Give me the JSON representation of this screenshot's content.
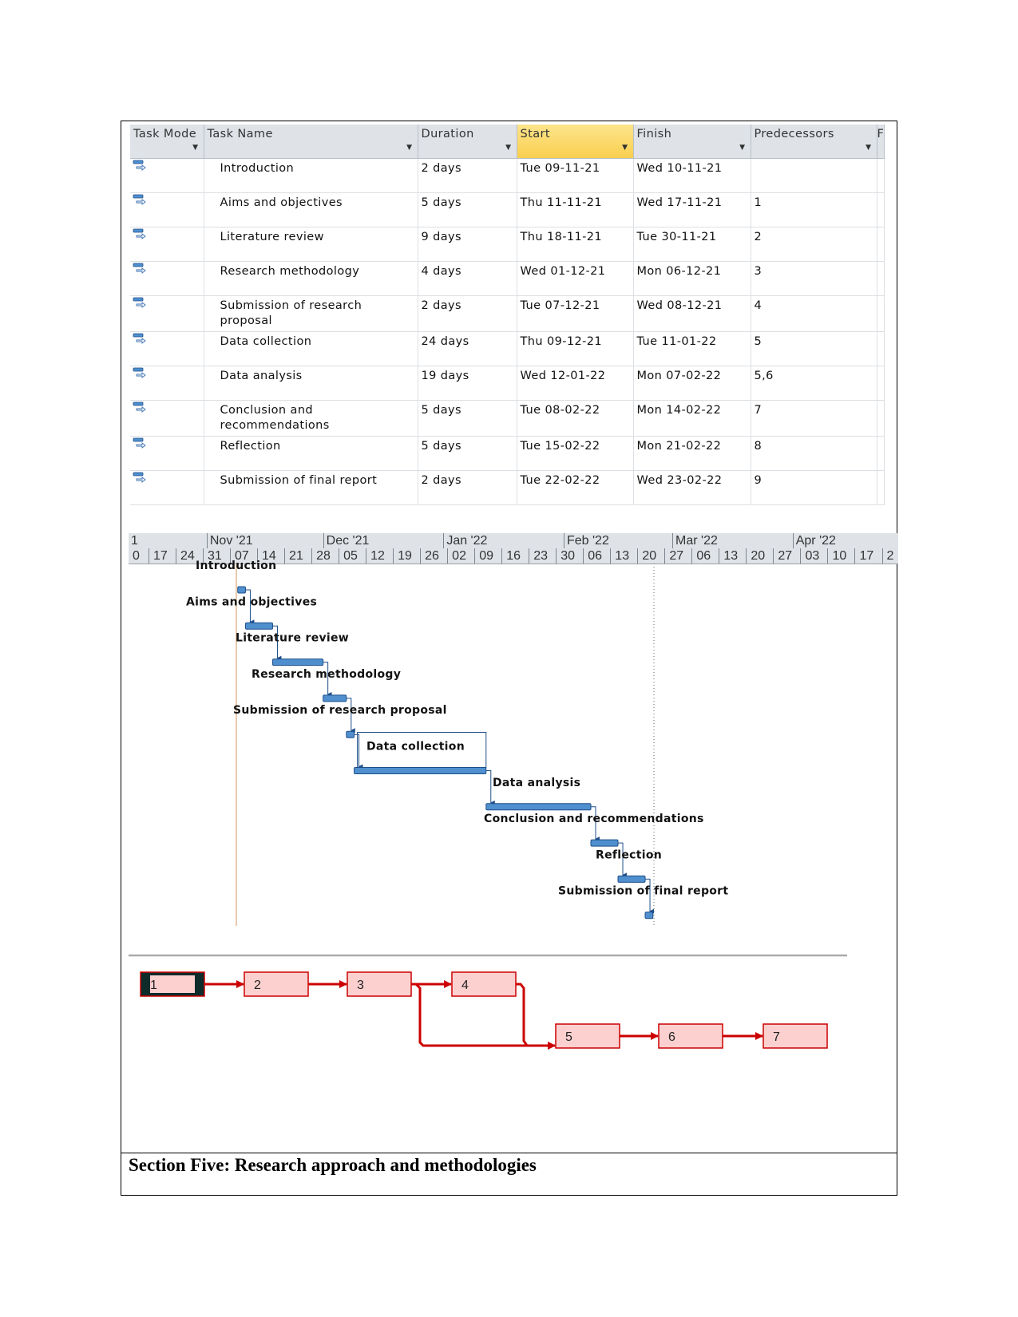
{
  "table": {
    "headers": [
      "Task Mode",
      "Task Name",
      "Duration",
      "Start",
      "Finish",
      "Predecessors",
      "F"
    ],
    "rows": [
      {
        "id": 1,
        "name": "Introduction",
        "duration": "2 days",
        "start": "Tue 09-11-21",
        "finish": "Wed 10-11-21",
        "predecessors": ""
      },
      {
        "id": 2,
        "name": "Aims and objectives",
        "duration": "5 days",
        "start": "Thu 11-11-21",
        "finish": "Wed 17-11-21",
        "predecessors": "1"
      },
      {
        "id": 3,
        "name": "Literature review",
        "duration": "9 days",
        "start": "Thu 18-11-21",
        "finish": "Tue 30-11-21",
        "predecessors": "2"
      },
      {
        "id": 4,
        "name": "Research methodology",
        "duration": "4 days",
        "start": "Wed 01-12-21",
        "finish": "Mon 06-12-21",
        "predecessors": "3"
      },
      {
        "id": 5,
        "name": "Submission of research proposal",
        "duration": "2 days",
        "start": "Tue 07-12-21",
        "finish": "Wed 08-12-21",
        "predecessors": "4"
      },
      {
        "id": 6,
        "name": "Data collection",
        "duration": "24 days",
        "start": "Thu 09-12-21",
        "finish": "Tue 11-01-22",
        "predecessors": "5"
      },
      {
        "id": 7,
        "name": "Data analysis",
        "duration": "19 days",
        "start": "Wed 12-01-22",
        "finish": "Mon 07-02-22",
        "predecessors": "5,6"
      },
      {
        "id": 8,
        "name": "Conclusion and recommendations",
        "duration": "5 days",
        "start": "Tue 08-02-22",
        "finish": "Mon 14-02-22",
        "predecessors": "7"
      },
      {
        "id": 9,
        "name": "Reflection",
        "duration": "5 days",
        "start": "Tue 15-02-22",
        "finish": "Mon 21-02-22",
        "predecessors": "8"
      },
      {
        "id": 10,
        "name": "Submission of final report",
        "duration": "2 days",
        "start": "Tue 22-02-22",
        "finish": "Wed 23-02-22",
        "predecessors": "9"
      }
    ],
    "task_mode_icon": "auto-scheduled-task-icon"
  },
  "timescale": {
    "months": [
      {
        "label": "1",
        "start": "01-10-21"
      },
      {
        "label": "Nov '21",
        "start": "01-11-21"
      },
      {
        "label": "Dec '21",
        "start": "01-12-21"
      },
      {
        "label": "Jan '22",
        "start": "01-01-22"
      },
      {
        "label": "Feb '22",
        "start": "01-02-22"
      },
      {
        "label": "Mar '22",
        "start": "01-03-22"
      },
      {
        "label": "Apr '22",
        "start": "01-04-22"
      }
    ],
    "weeks_first": "10-10-21",
    "weeks": [
      "0",
      "17",
      "24",
      "31",
      "07",
      "14",
      "21",
      "28",
      "05",
      "12",
      "19",
      "26",
      "02",
      "09",
      "16",
      "23",
      "30",
      "06",
      "13",
      "20",
      "27",
      "06",
      "13",
      "20",
      "27",
      "03",
      "10",
      "17",
      "2"
    ]
  },
  "colors": {
    "bar": "#4f8fce",
    "bar_dark": "#1f4f8a",
    "project_start_line": "#d9a878",
    "network_border": "#cc0000",
    "network_fill": "#fdd0d0",
    "network_selected": "#0d2b2b"
  },
  "network": {
    "nodes": [
      "1",
      "2",
      "3",
      "4",
      "5",
      "6",
      "7"
    ],
    "links": [
      [
        "1",
        "2"
      ],
      [
        "2",
        "3"
      ],
      [
        "3",
        "4"
      ],
      [
        "3",
        "5"
      ],
      [
        "4",
        "5"
      ],
      [
        "5",
        "6"
      ],
      [
        "6",
        "7"
      ]
    ]
  },
  "section_title": "Section Five: Research approach and methodologies"
}
